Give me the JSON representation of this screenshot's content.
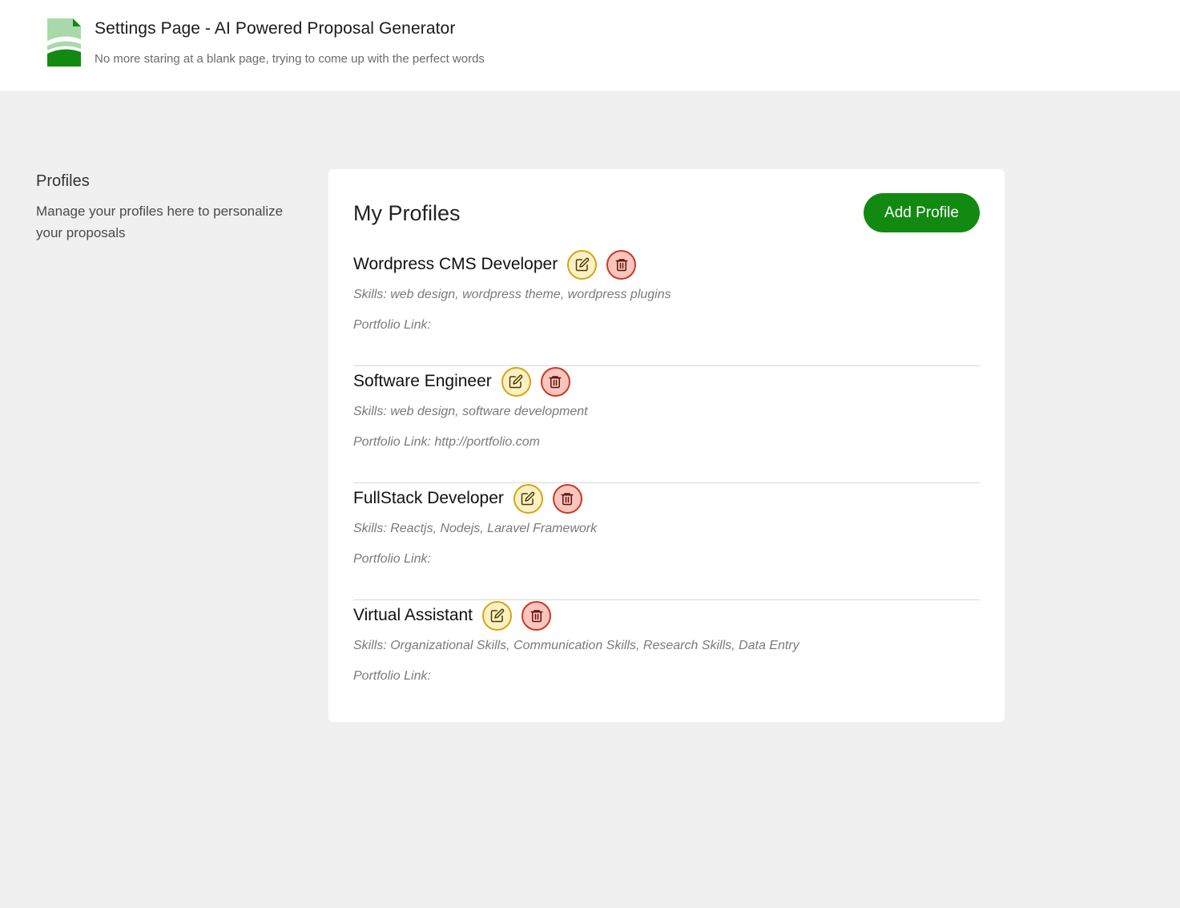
{
  "header": {
    "title": "Settings Page - AI Powered Proposal Generator",
    "subtitle": "No more staring at a blank page, trying to come up with the perfect words",
    "logo_icon": "document-logo-icon"
  },
  "sidebar": {
    "title": "Profiles",
    "description": "Manage your profiles here to personalize your proposals"
  },
  "main": {
    "title": "My Profiles",
    "add_button_label": "Add Profile",
    "profiles": [
      {
        "name": "Wordpress CMS Developer",
        "skills": "Skills: web design, wordpress theme, wordpress plugins",
        "portfolio": "Portfolio Link:"
      },
      {
        "name": "Software Engineer",
        "skills": "Skills: web design, software development",
        "portfolio": "Portfolio Link: http://portfolio.com"
      },
      {
        "name": "FullStack Developer",
        "skills": "Skills: Reactjs, Nodejs, Laravel Framework",
        "portfolio": "Portfolio Link:"
      },
      {
        "name": "Virtual Assistant",
        "skills": "Skills: Organizational Skills, Communication Skills, Research Skills, Data Entry",
        "portfolio": "Portfolio Link:"
      }
    ]
  },
  "icons": {
    "edit": "edit-icon",
    "delete": "trash-icon"
  },
  "colors": {
    "accent": "#128a12",
    "edit_bg": "#fdf1c4",
    "edit_border": "#d4a516",
    "delete_bg": "#f9c5bd",
    "delete_border": "#c83a26",
    "page_bg": "#f0f0f0"
  }
}
